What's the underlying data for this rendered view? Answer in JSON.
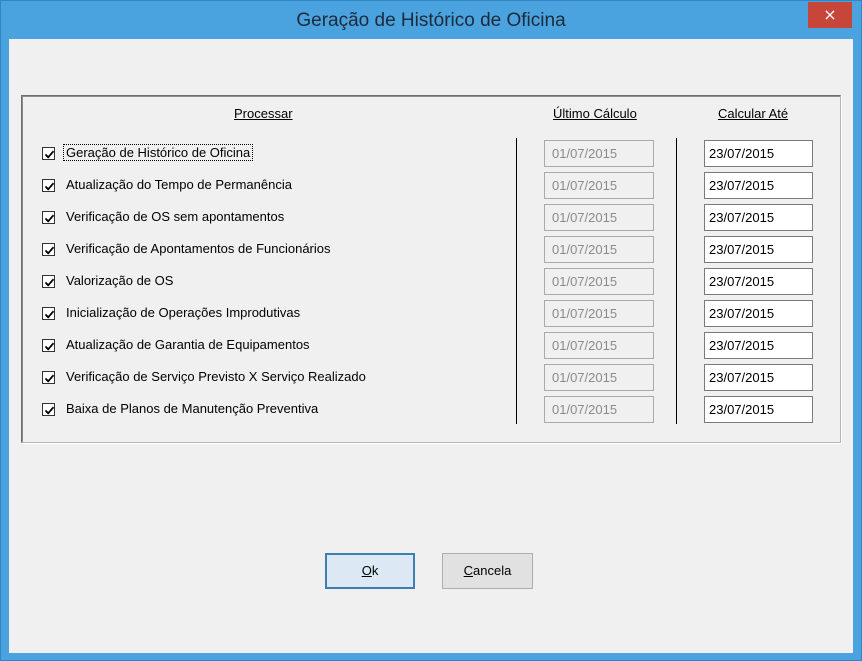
{
  "window": {
    "title": "Geração de Histórico de Oficina",
    "close_glyph": "×"
  },
  "headers": {
    "processar": "Processar",
    "ultimo_calculo": "Último Cálculo",
    "calcular_ate": "Calcular Até"
  },
  "rows": [
    {
      "label": "Geração de Histórico de Oficina",
      "checked": true,
      "ultimo": "01/07/2015",
      "calcular": "23/07/2015"
    },
    {
      "label": "Atualização do Tempo de Permanência",
      "checked": true,
      "ultimo": "01/07/2015",
      "calcular": "23/07/2015"
    },
    {
      "label": "Verificação de OS sem apontamentos",
      "checked": true,
      "ultimo": "01/07/2015",
      "calcular": "23/07/2015"
    },
    {
      "label": "Verificação de Apontamentos de Funcionários",
      "checked": true,
      "ultimo": "01/07/2015",
      "calcular": "23/07/2015"
    },
    {
      "label": "Valorização de OS",
      "checked": true,
      "ultimo": "01/07/2015",
      "calcular": "23/07/2015"
    },
    {
      "label": "Inicialização de Operações Improdutivas",
      "checked": true,
      "ultimo": "01/07/2015",
      "calcular": "23/07/2015"
    },
    {
      "label": "Atualização de Garantia de Equipamentos",
      "checked": true,
      "ultimo": "01/07/2015",
      "calcular": "23/07/2015"
    },
    {
      "label": "Verificação de Serviço Previsto X Serviço Realizado",
      "checked": true,
      "ultimo": "01/07/2015",
      "calcular": "23/07/2015"
    },
    {
      "label": "Baixa de Planos de Manutenção Preventiva",
      "checked": true,
      "ultimo": "01/07/2015",
      "calcular": "23/07/2015"
    }
  ],
  "buttons": {
    "ok_mnemonic": "O",
    "ok_rest": "k",
    "cancel_mnemonic": "C",
    "cancel_rest": "ancela"
  }
}
